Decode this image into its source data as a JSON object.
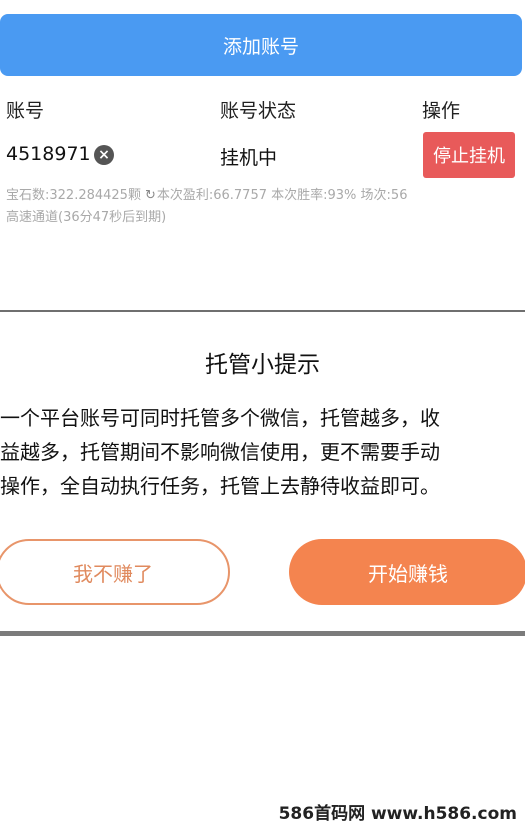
{
  "top": {
    "add_account_label": "添加账号"
  },
  "table": {
    "headers": {
      "account": "账号",
      "status": "账号状态",
      "operation": "操作"
    },
    "row": {
      "account_id": "4518971",
      "remove_icon": "close-circle-icon",
      "remove_glyph": "×",
      "status": "挂机中",
      "stop_label": "停止挂机"
    },
    "stats": {
      "gems": "宝石数:322.284425颗",
      "refresh_icon": "refresh-icon",
      "refresh_glyph": "↻",
      "rest": "本次盈利:66.7757 本次胜率:93% 场次:56"
    },
    "channel": "高速通道(36分47秒后到期)"
  },
  "modal": {
    "title": "托管小提示",
    "body_lines": [
      "一个平台账号可同时托管多个微信，托管越多，收",
      "益越多，托管期间不影响微信使用，更不需要手动",
      "操作，全自动执行任务，托管上去静待收益即可。"
    ],
    "cancel_label": "我不赚了",
    "start_label": "开始赚钱"
  },
  "watermark": "586首码网 www.h586.com",
  "colors": {
    "primary_blue": "#4a9af2",
    "stop_red": "#e85a5a",
    "accent_orange": "#f4844f"
  }
}
